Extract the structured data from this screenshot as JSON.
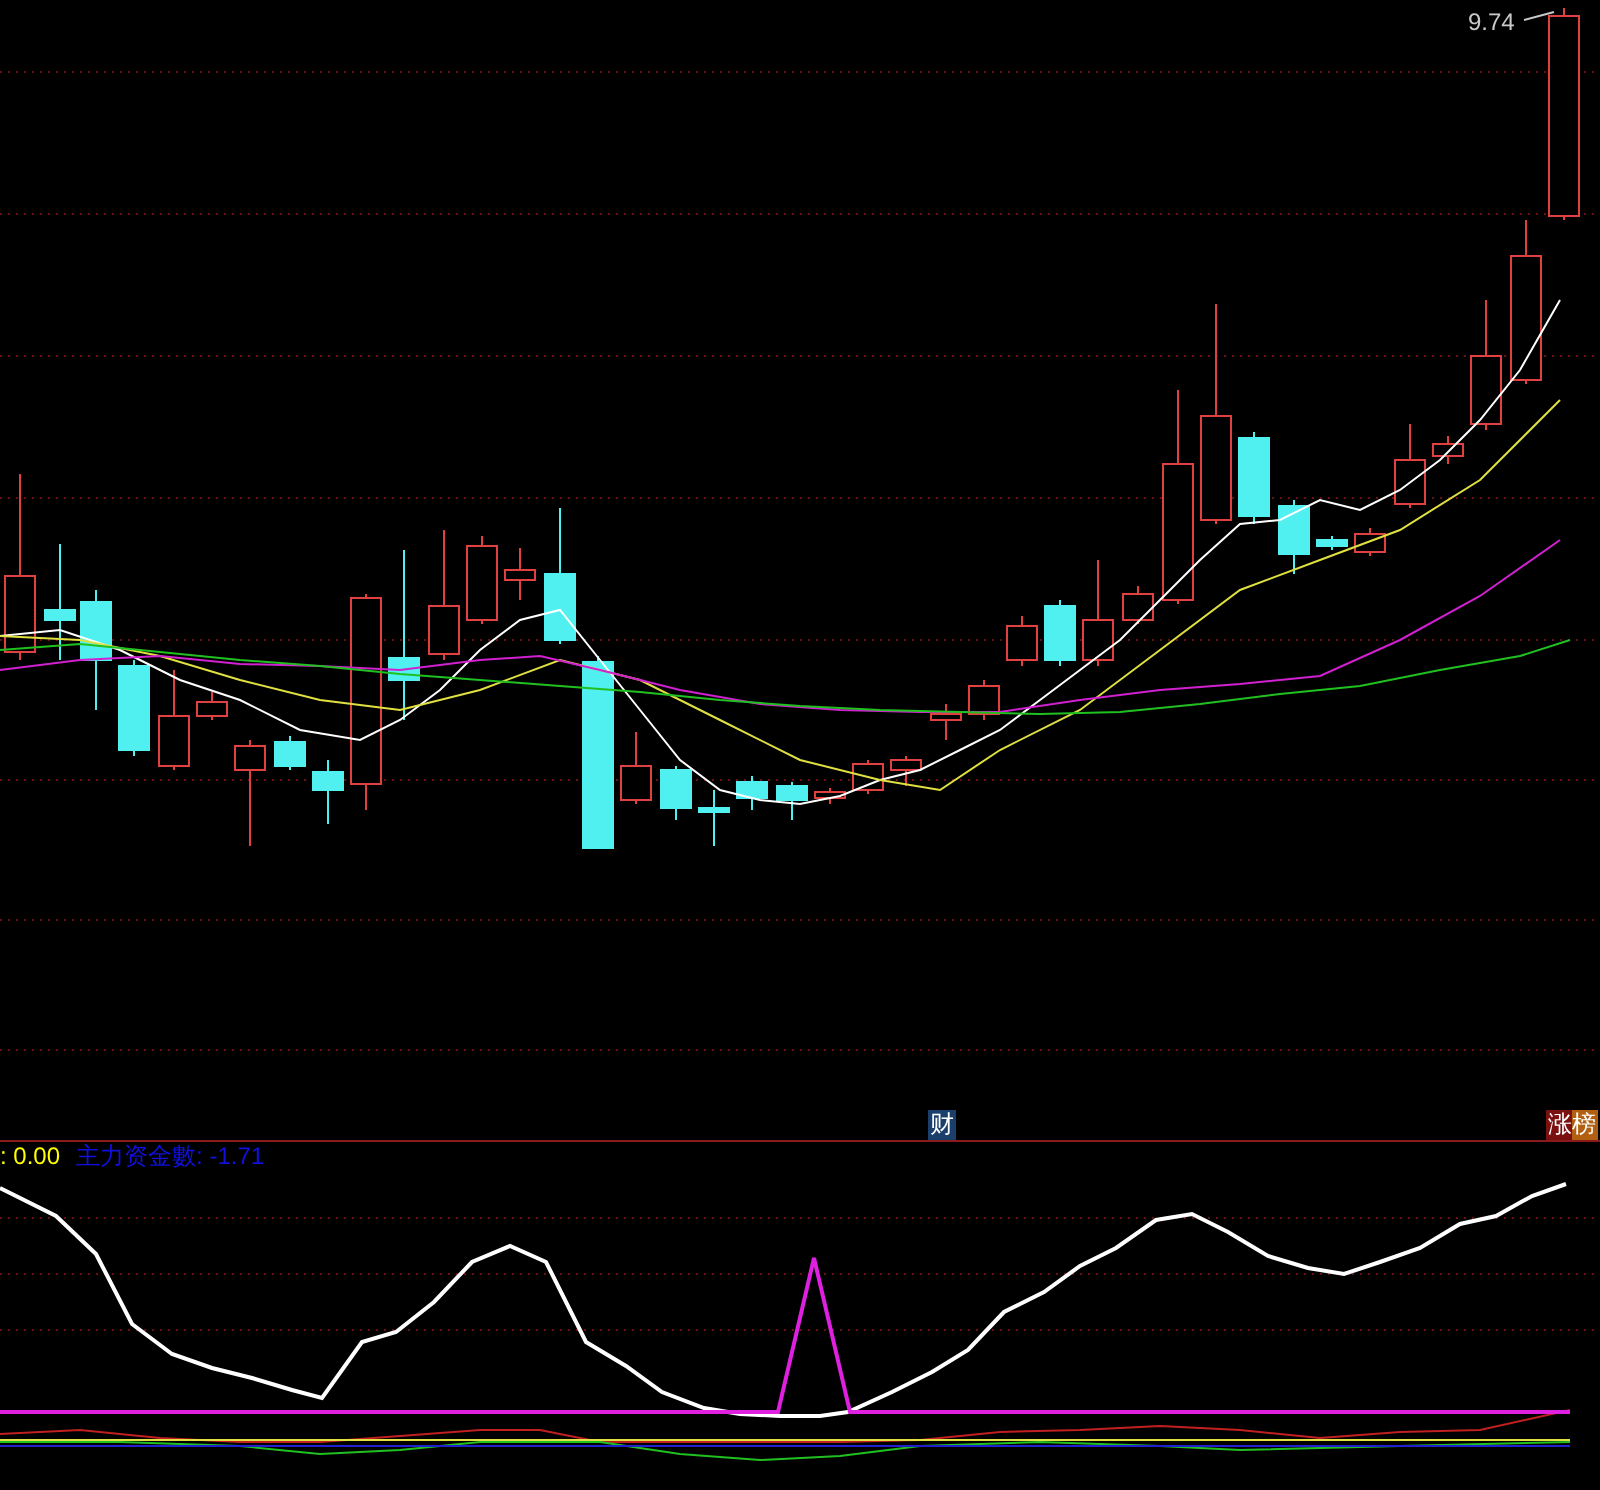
{
  "price_panel": {
    "max_price_label": "9.74",
    "tags": [
      {
        "text": "财",
        "kind": "finance"
      },
      {
        "text": "涨榜",
        "kind": "ranking"
      }
    ]
  },
  "indicator_panel": {
    "values": [
      {
        "label": ": 0.00",
        "color": "#ffff00"
      },
      {
        "label": "主力资金數: -1.71",
        "color": "#1010e0"
      }
    ]
  }
}
